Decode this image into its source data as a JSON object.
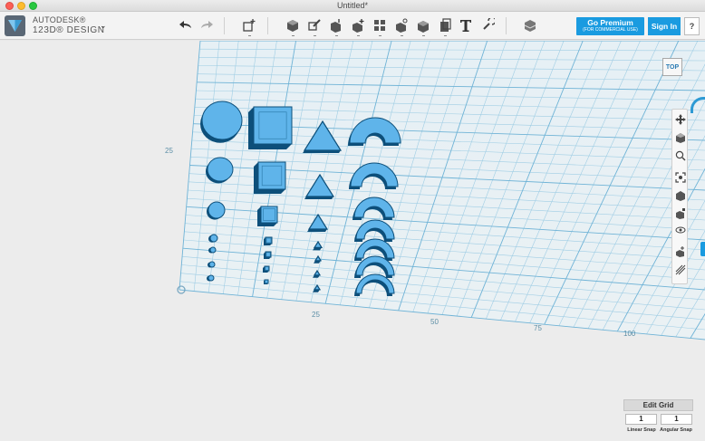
{
  "window": {
    "title": "Untitled*"
  },
  "brand": {
    "line1": "AUTODESK®",
    "line2": "123D® DESIGN",
    "menu_caret": "⌄"
  },
  "toolbar": {
    "undo_icon": "undo-icon",
    "redo_icon": "redo-icon",
    "tools": [
      "transform-icon",
      "primitives-icon",
      "sketch-icon",
      "construct-icon",
      "modify-icon",
      "pattern-icon",
      "group-icon",
      "combine-icon",
      "measure-icon",
      "text-icon",
      "snap-icon",
      "material-icon"
    ],
    "premium_label": "Go Premium",
    "premium_sub": "(FOR COMMERCIAL USE)",
    "signin_label": "Sign In",
    "help_label": "?"
  },
  "viewport": {
    "viewcube_label": "TOP",
    "axis_labels": {
      "y25": "25",
      "x25": "25",
      "x50": "50",
      "x75": "75",
      "x100": "100"
    },
    "grid_color": "#6fb3d6",
    "object_color": "#5fb4ea",
    "object_edge_color": "#0d4f7a"
  },
  "nav": {
    "tools": [
      "pan-icon",
      "orbit-icon",
      "zoom-icon",
      "fit-icon",
      "materials-outline-icon",
      "solid-icon",
      "hide-icon",
      "show-icon",
      "snap-grid-icon"
    ]
  },
  "grid_panel": {
    "edit_label": "Edit Grid",
    "linear_value": "1",
    "angular_value": "1",
    "linear_label": "Linear Snap",
    "angular_label": "Angular Snap"
  }
}
